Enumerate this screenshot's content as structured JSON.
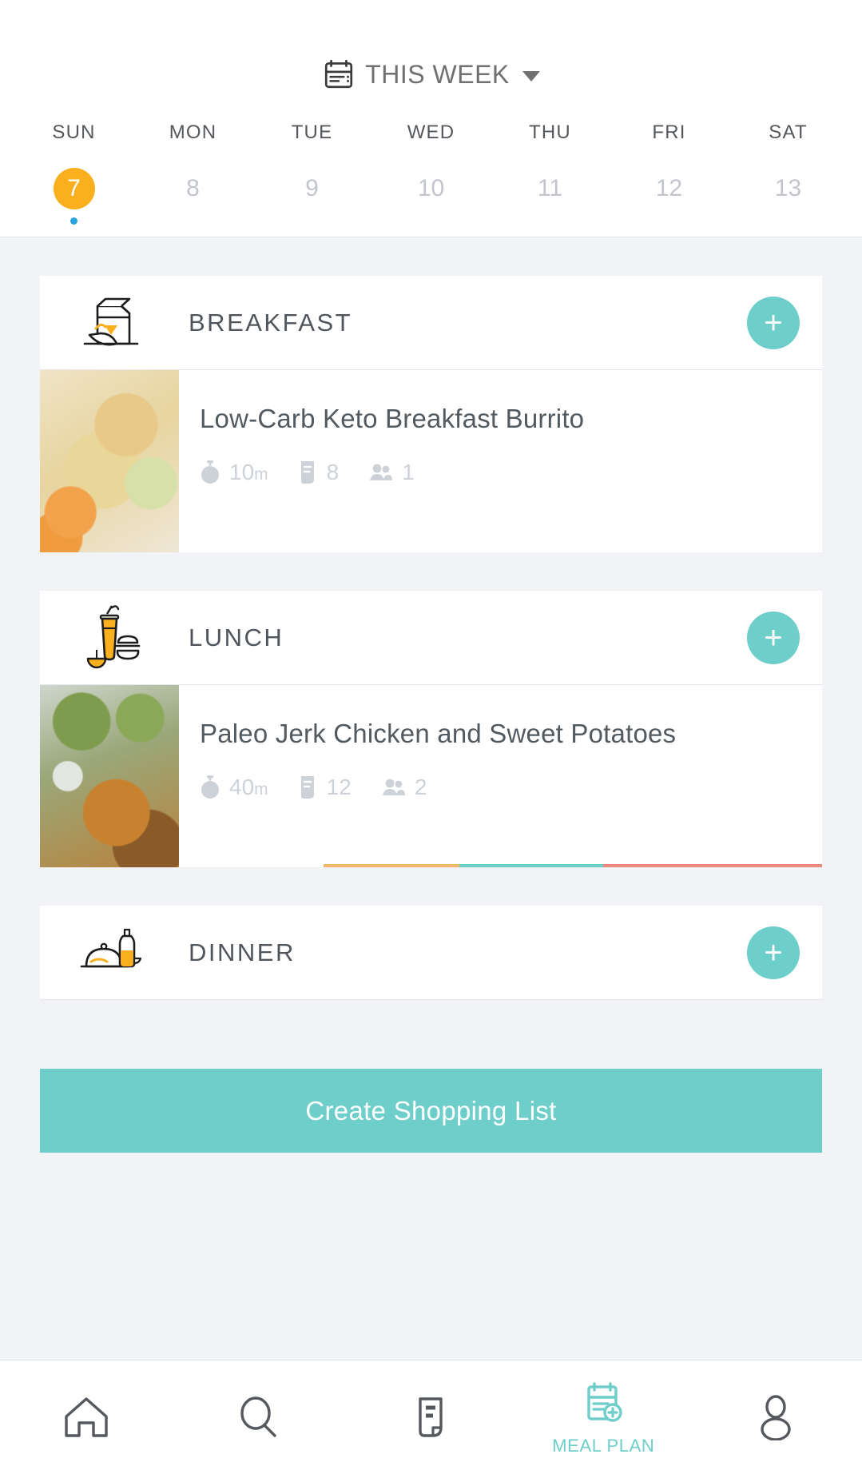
{
  "header": {
    "calendar_icon": "calendar-icon",
    "week_label": "THIS WEEK",
    "caret_icon": "chevron-down-icon",
    "weekdays": [
      "SUN",
      "MON",
      "TUE",
      "WED",
      "THU",
      "FRI",
      "SAT"
    ],
    "dates": [
      {
        "day": "7",
        "selected": true,
        "has_meals": true
      },
      {
        "day": "8",
        "selected": false,
        "has_meals": false
      },
      {
        "day": "9",
        "selected": false,
        "has_meals": false
      },
      {
        "day": "10",
        "selected": false,
        "has_meals": false
      },
      {
        "day": "11",
        "selected": false,
        "has_meals": false
      },
      {
        "day": "12",
        "selected": false,
        "has_meals": false
      },
      {
        "day": "13",
        "selected": false,
        "has_meals": false
      }
    ]
  },
  "meals": [
    {
      "name": "BREAKFAST",
      "icon": "milk-carton-breakfast-icon",
      "add_label": "+",
      "recipes": [
        {
          "title": "Low-Carb Keto Breakfast Burrito",
          "time": "10",
          "time_unit": "m",
          "ingredients": "8",
          "servings": "1",
          "photo": "burrito-photo"
        }
      ]
    },
    {
      "name": "LUNCH",
      "icon": "drink-burger-lunch-icon",
      "add_label": "+",
      "recipes": [
        {
          "title": "Paleo Jerk Chicken and Sweet Potatoes",
          "time": "40",
          "time_unit": "m",
          "ingredients": "12",
          "servings": "2",
          "photo": "jerk-chicken-photo"
        }
      ]
    },
    {
      "name": "DINNER",
      "icon": "cloche-wine-dinner-icon",
      "add_label": "+",
      "recipes": []
    }
  ],
  "shopping_button": {
    "label": "Create Shopping List"
  },
  "bottom_nav": [
    {
      "icon": "home-icon",
      "label": "",
      "active": false
    },
    {
      "icon": "search-icon",
      "label": "",
      "active": false
    },
    {
      "icon": "recipes-icon",
      "label": "",
      "active": false
    },
    {
      "icon": "meal-plan-icon",
      "label": "MEAL PLAN",
      "active": true
    },
    {
      "icon": "profile-icon",
      "label": "",
      "active": false
    }
  ],
  "colors": {
    "accent_teal": "#6DCECA",
    "selected_day_orange": "#FAAF1E",
    "meal_dot_blue": "#29A3DC",
    "page_background": "#F1F3F7",
    "text_dark": "#50565C",
    "text_muted": "#CCD2D7"
  }
}
